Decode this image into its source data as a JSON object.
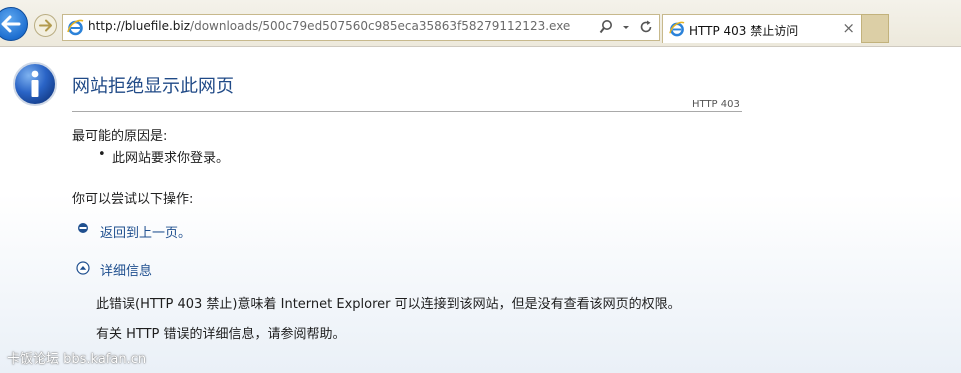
{
  "browser": {
    "url_host": "http://bluefile.biz",
    "url_path": "/downloads/500c79ed507560c985eca35863f58279112123.exe",
    "tab_title": "HTTP 403 禁止访问",
    "tab_close": "×",
    "icons": [
      "back-arrow-icon",
      "forward-arrow-icon",
      "ie-logo-icon",
      "search-icon",
      "dropdown-icon",
      "refresh-icon",
      "close-icon"
    ],
    "accent": "#1e6fd0"
  },
  "error": {
    "title": "网站拒绝显示此网页",
    "code": "HTTP 403",
    "reason_heading": "最可能的原因是:",
    "reasons": [
      "此网站要求你登录。"
    ],
    "try_heading": "你可以尝试以下操作:",
    "back_link": "返回到上一页。",
    "more_info": "详细信息",
    "detail_1": "此错误(HTTP 403 禁止)意味着 Internet Explorer 可以连接到该网站，但是没有查看该网页的权限。",
    "detail_2": "有关 HTTP 错误的详细信息，请参阅帮助。",
    "title_color": "#204a87",
    "link_color": "#1f4f8f"
  },
  "watermark": "卡饭论坛 bbs.kafan.cn"
}
